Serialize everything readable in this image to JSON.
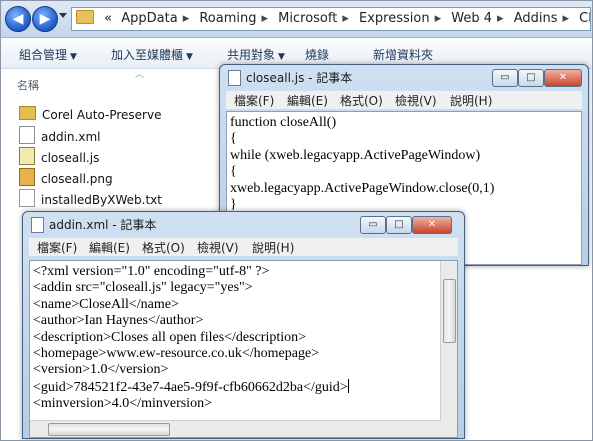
{
  "explorer": {
    "breadcrumb": [
      "«",
      "AppData",
      "Roaming",
      "Microsoft",
      "Expression",
      "Web 4",
      "Addins",
      "CloseAll"
    ],
    "toolbar": {
      "organize": "組合管理",
      "include_in_library": "加入至媒體櫃",
      "share_with": "共用對象",
      "burn": "燒錄",
      "new_folder": "新增資料夾"
    },
    "column_name": "名稱",
    "files": [
      {
        "name": "Corel Auto-Preserve",
        "type": "folder"
      },
      {
        "name": "addin.xml",
        "type": "xml"
      },
      {
        "name": "closeall.js",
        "type": "js"
      },
      {
        "name": "closeall.png",
        "type": "png"
      },
      {
        "name": "installedByXWeb.txt",
        "type": "txt"
      }
    ]
  },
  "notepad_js": {
    "title": "closeall.js - 記事本",
    "menu": [
      "檔案(F)",
      "編輯(E)",
      "格式(O)",
      "檢視(V)",
      "說明(H)"
    ],
    "lines": [
      "function closeAll()",
      "{",
      "while (xweb.legacyapp.ActivePageWindow)",
      "{",
      "xweb.legacyapp.ActivePageWindow.close(0,1)",
      "}"
    ]
  },
  "notepad_xml": {
    "title": "addin.xml - 記事本",
    "menu": [
      "檔案(F)",
      "編輯(E)",
      "格式(O)",
      "檢視(V)",
      "說明(H)"
    ],
    "lines": [
      "<?xml version=\"1.0\" encoding=\"utf-8\" ?>",
      "<addin src=\"closeall.js\" legacy=\"yes\">",
      "<name>CloseAll</name>",
      "<author>Ian Haynes</author>",
      "<description>Closes all open files</description>",
      "<homepage>www.ew-resource.co.uk</homepage>",
      "<version>1.0</version>",
      "<guid>784521f2-43e7-4ae5-9f9f-cfb60662d2ba</guid>",
      "<minversion>4.0</minversion>"
    ]
  },
  "window_controls": {
    "minimize": "▭",
    "maximize": "□",
    "close": "✕"
  }
}
